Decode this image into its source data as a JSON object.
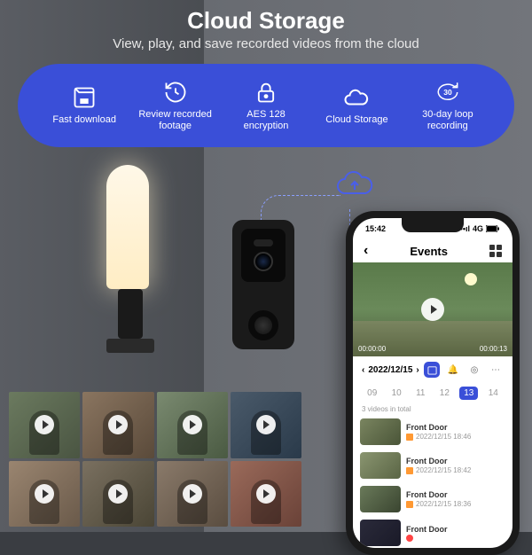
{
  "header": {
    "title": "Cloud Storage",
    "subtitle": "View, play, and save recorded videos from the cloud"
  },
  "features": [
    {
      "label": "Fast download"
    },
    {
      "label": "Review recorded footage"
    },
    {
      "label": "AES 128 encryption"
    },
    {
      "label": "Cloud Storage"
    },
    {
      "label": "30-day loop recording"
    }
  ],
  "phone": {
    "status": {
      "time": "15:42",
      "signal": "4G"
    },
    "screen_title": "Events",
    "date": "2022/12/15",
    "days": [
      "09",
      "10",
      "11",
      "12",
      "13",
      "14"
    ],
    "selected_day": "13",
    "count_text": "3 videos in total",
    "events": [
      {
        "title": "Front Door",
        "time": "2022/12/15 18:46"
      },
      {
        "title": "Front Door",
        "time": "2022/12/15 18:42"
      },
      {
        "title": "Front Door",
        "time": "2022/12/15 18:36"
      },
      {
        "title": "Front Door",
        "time": ""
      }
    ],
    "preview_time_left": "00:00:00",
    "preview_time_right": "00:00:13"
  }
}
